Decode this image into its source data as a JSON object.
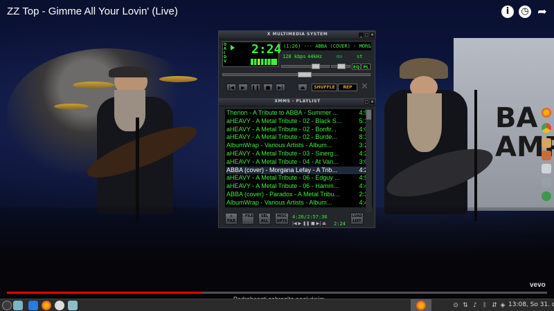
{
  "video": {
    "title": "ZZ Top - Gimme All Your Lovin' (Live)",
    "screen_text": [
      "BA",
      "AMPL"
    ],
    "watermark": "vevo",
    "caption": "Podrobnosti zobrazíte pozíváním"
  },
  "player_controls": {
    "info_icon": "info-icon",
    "watch_later_icon": "clock-icon",
    "share_icon": "share-icon",
    "progress_fraction": 0.36
  },
  "xmms": {
    "title": "X MULTIMEDIA SYSTEM",
    "time": "2:24",
    "marquee": "(1:26) --- ABBA (COVER) - MORGANA",
    "kbps": "128",
    "kbps_unit": "kbps",
    "khz": "44",
    "khz_unit": "kHz",
    "stereo": "st",
    "mono": "mo",
    "eq": "EQ",
    "pl": "PL",
    "shuffle": "SHUFFLE",
    "repeat": "REP",
    "mode_letters": [
      "O",
      "A",
      "I",
      "D",
      "V"
    ],
    "controls": {
      "prev": "|◀",
      "play": "▶",
      "pause": "❚❚",
      "stop": "■",
      "next": "▶|",
      "eject": "⏏"
    }
  },
  "playlist": {
    "title": "XMMS - PLAYLIST",
    "rows": [
      {
        "name": "Therion - A Tribute to ABBA - Summer ...",
        "dur": "4:58"
      },
      {
        "name": "aHEAVY - A Metal Tribute - 02 - Black S...",
        "dur": "5:12"
      },
      {
        "name": "aHEAVY - A Metal Tribute - 02 - Bonfir...",
        "dur": "4:09"
      },
      {
        "name": "aHEAVY - A Metal Tribute - 02 - Burde...",
        "dur": "8:31"
      },
      {
        "name": "AlbumWrap - Various Artists - Album...",
        "dur": "3:23"
      },
      {
        "name": "aHEAVY - A Metal Tribute - 03 - Sinerg...",
        "dur": "4:22"
      },
      {
        "name": "aHEAVY - A Metal Tribute - 04 - At Van...",
        "dur": "3:09"
      },
      {
        "name": "ABBA (cover) - Morgana Lefay - A Trib...",
        "dur": "4:26"
      },
      {
        "name": "aHEAVY - A Metal Tribute - 06 - Edguy ...",
        "dur": "4:55"
      },
      {
        "name": "aHEAVY - A Metal Tribute - 06 - Hamm...",
        "dur": "4:40"
      },
      {
        "name": "ABBA (cover) - Paradox - A Metal Tribu...",
        "dur": "2:36"
      },
      {
        "name": "AlbumWrap - Various Artists - Album...",
        "dur": "4:47"
      }
    ],
    "buttons": {
      "add": "+ FILE",
      "remove": "- FILE",
      "select": "SEL ALL",
      "misc": "MISC OPTS",
      "list": "LOAD LIST"
    },
    "time_info": "4:26/2:57:36",
    "time_small": "2:24"
  },
  "taskbar": {
    "clock": "13:08, So 31. dec",
    "tray_icons": [
      "steam-icon",
      "network-icon",
      "volume-icon",
      "bluetooth-icon"
    ]
  },
  "colors": {
    "lcd_green": "#3ef03e",
    "progress_red": "#ee0000",
    "taskbar": "#2b2b2b"
  }
}
